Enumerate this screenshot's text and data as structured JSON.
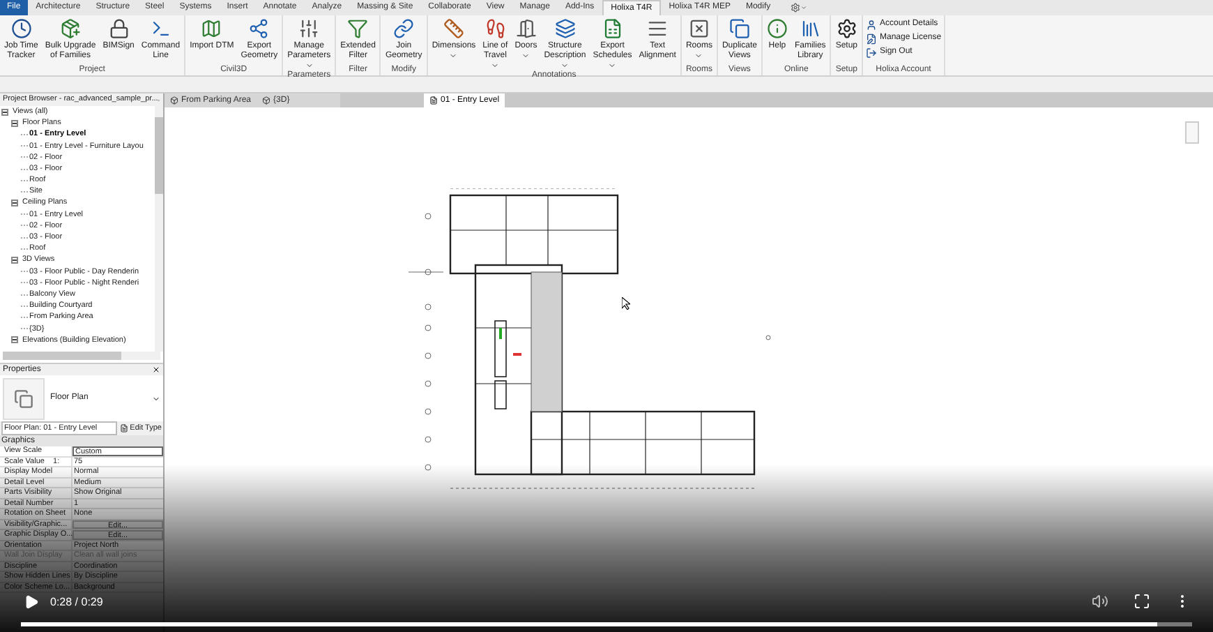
{
  "ribbon_tabs": [
    {
      "label": "File",
      "kind": "app",
      "selected": false
    },
    {
      "label": "Architecture",
      "kind": "tab",
      "selected": false
    },
    {
      "label": "Structure",
      "kind": "tab",
      "selected": false
    },
    {
      "label": "Steel",
      "kind": "tab",
      "selected": false
    },
    {
      "label": "Systems",
      "kind": "tab",
      "selected": false
    },
    {
      "label": "Insert",
      "kind": "tab",
      "selected": false
    },
    {
      "label": "Annotate",
      "kind": "tab",
      "selected": false
    },
    {
      "label": "Analyze",
      "kind": "tab",
      "selected": false
    },
    {
      "label": "Massing & Site",
      "kind": "tab",
      "selected": false
    },
    {
      "label": "Collaborate",
      "kind": "tab",
      "selected": false
    },
    {
      "label": "View",
      "kind": "tab",
      "selected": false
    },
    {
      "label": "Manage",
      "kind": "tab",
      "selected": false
    },
    {
      "label": "Add-Ins",
      "kind": "tab",
      "selected": false
    },
    {
      "label": "Holixa T4R",
      "kind": "tab",
      "selected": true
    },
    {
      "label": "Holixa T4R MEP",
      "kind": "tab",
      "selected": false
    },
    {
      "label": "Modify",
      "kind": "tab",
      "selected": false
    }
  ],
  "ribbon_panels": [
    {
      "title": "Project",
      "buttons": [
        {
          "label": "Job Time\nTracker",
          "dropdown": false
        },
        {
          "label": "Bulk Upgrade\nof Families",
          "dropdown": false
        },
        {
          "label": "BIMSign",
          "dropdown": false
        },
        {
          "label": "Command\nLine",
          "dropdown": false
        }
      ]
    },
    {
      "title": "Civil3D",
      "buttons": [
        {
          "label": "Import DTM",
          "dropdown": false
        },
        {
          "label": "Export\nGeometry",
          "dropdown": false
        }
      ]
    },
    {
      "title": "Parameters",
      "buttons": [
        {
          "label": "Manage\nParameters",
          "dropdown": true
        }
      ]
    },
    {
      "title": "Filter",
      "buttons": [
        {
          "label": "Extended\nFilter",
          "dropdown": false
        }
      ]
    },
    {
      "title": "Modify",
      "buttons": [
        {
          "label": "Join\nGeometry",
          "dropdown": false
        }
      ]
    },
    {
      "title": "Annotations",
      "buttons": [
        {
          "label": "Dimensions",
          "dropdown": true
        },
        {
          "label": "Line of\nTravel",
          "dropdown": true
        },
        {
          "label": "Doors",
          "dropdown": true
        },
        {
          "label": "Structure\nDescription",
          "dropdown": true
        },
        {
          "label": "Export\nSchedules",
          "dropdown": true
        },
        {
          "label": "Text\nAlignment",
          "dropdown": false
        }
      ]
    },
    {
      "title": "Rooms",
      "buttons": [
        {
          "label": "Rooms",
          "dropdown": true
        }
      ]
    },
    {
      "title": "Views",
      "buttons": [
        {
          "label": "Duplicate\nViews",
          "dropdown": false
        }
      ]
    },
    {
      "title": "Online",
      "buttons": [
        {
          "label": "Help",
          "dropdown": false
        },
        {
          "label": "Families\nLibrary",
          "dropdown": false
        }
      ]
    },
    {
      "title": "Setup",
      "buttons": [
        {
          "label": "Setup",
          "dropdown": false
        }
      ]
    },
    {
      "title": "Holixa Account",
      "small_buttons": [
        "Account Details",
        "Manage License",
        "Sign Out"
      ]
    }
  ],
  "project_browser": {
    "title": "Project Browser - rac_advanced_sample_pr...",
    "tree": [
      {
        "label": "Views (all)",
        "expanded": true,
        "selected": false,
        "children": [
          {
            "label": "Floor Plans",
            "expanded": true,
            "selected": false,
            "children": [
              {
                "label": "01 - Entry Level",
                "selected": true
              },
              {
                "label": "01 - Entry Level - Furniture Layou",
                "selected": false
              },
              {
                "label": "02 - Floor",
                "selected": false
              },
              {
                "label": "03 - Floor",
                "selected": false
              },
              {
                "label": "Roof",
                "selected": false
              },
              {
                "label": "Site",
                "selected": false
              }
            ]
          },
          {
            "label": "Ceiling Plans",
            "expanded": true,
            "selected": false,
            "children": [
              {
                "label": "01 - Entry Level",
                "selected": false
              },
              {
                "label": "02 - Floor",
                "selected": false
              },
              {
                "label": "03 - Floor",
                "selected": false
              },
              {
                "label": "Roof",
                "selected": false
              }
            ]
          },
          {
            "label": "3D Views",
            "expanded": true,
            "selected": false,
            "children": [
              {
                "label": "03 - Floor Public - Day Renderin",
                "selected": false
              },
              {
                "label": "03 - Floor Public - Night Renderi",
                "selected": false
              },
              {
                "label": "Balcony View",
                "selected": false
              },
              {
                "label": "Building Courtyard",
                "selected": false
              },
              {
                "label": "From Parking Area",
                "selected": false
              },
              {
                "label": "{3D}",
                "selected": false
              }
            ]
          },
          {
            "label": "Elevations (Building Elevation)",
            "expanded": true,
            "selected": false
          }
        ]
      }
    ]
  },
  "view_tabs": [
    {
      "label": "From Parking Area",
      "kind": "model",
      "selected": false
    },
    {
      "label": "{3D}",
      "kind": "model",
      "selected": false
    },
    {
      "label": "01 - Entry Level",
      "kind": "plan",
      "selected": true
    }
  ],
  "properties": {
    "title": "Properties",
    "type_name": "Floor Plan",
    "instance": "Floor Plan: 01 - Entry Level",
    "edit_type": "Edit Type",
    "section": "Graphics",
    "rows": [
      {
        "label": "View Scale",
        "value": "Custom",
        "kind": "field",
        "disabled": false
      },
      {
        "label": "Scale Value    1:",
        "value": "75",
        "kind": "text",
        "disabled": false
      },
      {
        "label": "Display Model",
        "value": "Normal",
        "kind": "text",
        "disabled": false
      },
      {
        "label": "Detail Level",
        "value": "Medium",
        "kind": "text",
        "disabled": false
      },
      {
        "label": "Parts Visibility",
        "value": "Show Original",
        "kind": "text",
        "disabled": false
      },
      {
        "label": "Detail Number",
        "value": "1",
        "kind": "text",
        "disabled": false
      },
      {
        "label": "Rotation on Sheet",
        "value": "None",
        "kind": "text",
        "disabled": false
      },
      {
        "label": "Visibility/Graphic...",
        "value": "Edit...",
        "kind": "button",
        "disabled": false
      },
      {
        "label": "Graphic Display O...",
        "value": "Edit...",
        "kind": "button",
        "disabled": false
      },
      {
        "label": "Orientation",
        "value": "Project North",
        "kind": "text",
        "disabled": false
      },
      {
        "label": "Wall Join Display",
        "value": "Clean all wall joins",
        "kind": "text",
        "disabled": true
      },
      {
        "label": "Discipline",
        "value": "Coordination",
        "kind": "text",
        "disabled": false
      },
      {
        "label": "Show Hidden Lines",
        "value": "By Discipline",
        "kind": "text",
        "disabled": false
      },
      {
        "label": "Color Scheme Lo...",
        "value": "Background",
        "kind": "text",
        "disabled": false
      }
    ]
  },
  "video_player": {
    "time": "0:28 / 0:29",
    "progress": {
      "level": 0.97
    }
  }
}
